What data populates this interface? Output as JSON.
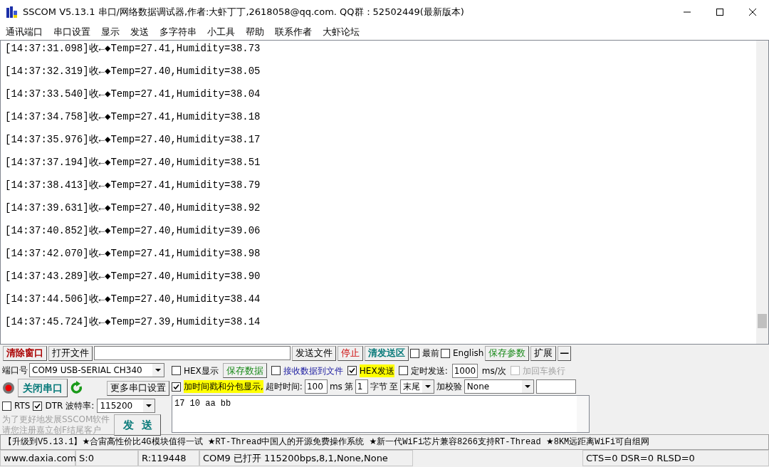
{
  "window": {
    "title": "SSCOM V5.13.1 串口/网络数据调试器,作者:大虾丁丁,2618058@qq.com. QQ群：52502449(最新版本)"
  },
  "menu": [
    "通讯端口",
    "串口设置",
    "显示",
    "发送",
    "多字符串",
    "小工具",
    "帮助",
    "联系作者",
    "大虾论坛"
  ],
  "log": [
    "[14:37:31.098]收←◆Temp=27.41,Humidity=38.73",
    "[14:37:32.319]收←◆Temp=27.40,Humidity=38.05",
    "[14:37:33.540]收←◆Temp=27.41,Humidity=38.04",
    "[14:37:34.758]收←◆Temp=27.41,Humidity=38.18",
    "[14:37:35.976]收←◆Temp=27.40,Humidity=38.17",
    "[14:37:37.194]收←◆Temp=27.40,Humidity=38.51",
    "[14:37:38.413]收←◆Temp=27.41,Humidity=38.79",
    "[14:37:39.631]收←◆Temp=27.40,Humidity=38.92",
    "[14:37:40.852]收←◆Temp=27.40,Humidity=39.06",
    "[14:37:42.070]收←◆Temp=27.41,Humidity=38.98",
    "[14:37:43.289]收←◆Temp=27.40,Humidity=38.90",
    "[14:37:44.506]收←◆Temp=27.40,Humidity=38.44",
    "[14:37:45.724]收←◆Temp=27.39,Humidity=38.14"
  ],
  "toolbar": {
    "clear_window": "清除窗口",
    "open_file": "打开文件",
    "send_file": "发送文件",
    "stop": "停止",
    "clear_send": "清发送区",
    "checks": [
      {
        "label": "最前",
        "checked": false
      },
      {
        "label": "English",
        "checked": false
      }
    ],
    "save_params": "保存参数",
    "expand": "扩展",
    "collapse": "—"
  },
  "port": {
    "label": "端口号",
    "value": "COM9 USB-SERIAL CH340",
    "close_port": "关闭串口",
    "more_settings": "更多串口设置",
    "rts": {
      "label": "RTS",
      "checked": false
    },
    "dtr": {
      "label": "DTR",
      "checked": true
    },
    "baud_label": "波特率:",
    "baud": "115200",
    "promo": [
      "为了更好地发展SSCOM软件",
      "请您注册嘉立创F结尾客户"
    ],
    "send": "发  送"
  },
  "options": {
    "hex_display": {
      "label": "HEX显示",
      "checked": false
    },
    "save_data": "保存数据",
    "recv_to_file": {
      "label": "接收数据到文件",
      "checked": false
    },
    "hex_send": {
      "label": "HEX发送",
      "checked": true
    },
    "timed_send": {
      "label": "定时发送:",
      "checked": false
    },
    "interval": "1000",
    "interval_unit": "ms/次",
    "add_crlf": {
      "label": "加回车换行",
      "checked": false,
      "disabled": true
    },
    "timestamp": {
      "label": "加时间戳和分包显示,",
      "checked": true
    },
    "timeout_label": "超时时间:",
    "timeout": "100",
    "timeout_unit": "ms",
    "byte_prefix": "第",
    "byte_from": "1",
    "byte_label": "字节",
    "to_label": "至",
    "byte_to": "末尾",
    "checksum_label": "加校验",
    "checksum": "None"
  },
  "send_text": "17 10 aa bb",
  "marquee": "【升级到V5.13.1】★合宙高性价比4G模块值得一试 ★RT-Thread中国人的开源免费操作系统 ★新一代WiFi芯片兼容8266支持RT-Thread ★8KM远距离WiFi可自组网",
  "status": [
    "www.daxia.com",
    "S:0",
    "R:119448",
    "COM9 已打开  115200bps,8,1,None,None",
    "CTS=0 DSR=0 RLSD=0"
  ]
}
